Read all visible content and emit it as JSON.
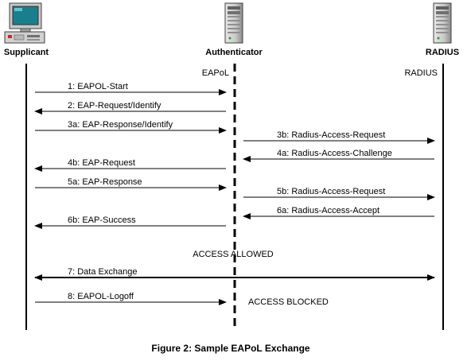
{
  "actors": {
    "supplicant": "Supplicant",
    "authenticator": "Authenticator",
    "radius": "RADIUS"
  },
  "lane_labels": {
    "eapol": "EAPoL",
    "radius": "RADIUS"
  },
  "messages": [
    {
      "label": "1: EAPOL-Start",
      "from": "supplicant",
      "to": "authenticator"
    },
    {
      "label": "2: EAP-Request/Identify",
      "from": "authenticator",
      "to": "supplicant"
    },
    {
      "label": "3a: EAP-Response/Identify",
      "from": "supplicant",
      "to": "authenticator"
    },
    {
      "label": "3b: Radius-Access-Request",
      "from": "authenticator",
      "to": "radius"
    },
    {
      "label": "4a: Radius-Access-Challenge",
      "from": "radius",
      "to": "authenticator"
    },
    {
      "label": "4b: EAP-Request",
      "from": "authenticator",
      "to": "supplicant"
    },
    {
      "label": "5a: EAP-Response",
      "from": "supplicant",
      "to": "authenticator"
    },
    {
      "label": "5b: Radius-Access-Request",
      "from": "authenticator",
      "to": "radius"
    },
    {
      "label": "6a: Radius-Access-Accept",
      "from": "radius",
      "to": "authenticator"
    },
    {
      "label": "6b: EAP-Success",
      "from": "authenticator",
      "to": "supplicant"
    },
    {
      "label": "7: Data Exchange",
      "from": "supplicant",
      "to": "radius",
      "bidirectional": true
    },
    {
      "label": "8: EAPOL-Logoff",
      "from": "supplicant",
      "to": "authenticator"
    }
  ],
  "notes": {
    "access_allowed": "ACCESS ALLOWED",
    "access_blocked": "ACCESS BLOCKED"
  },
  "caption": "Figure 2: Sample EAPoL Exchange",
  "icons": {
    "supplicant": "desktop-computer-icon",
    "authenticator": "server-tower-icon",
    "radius": "server-tower-icon"
  }
}
